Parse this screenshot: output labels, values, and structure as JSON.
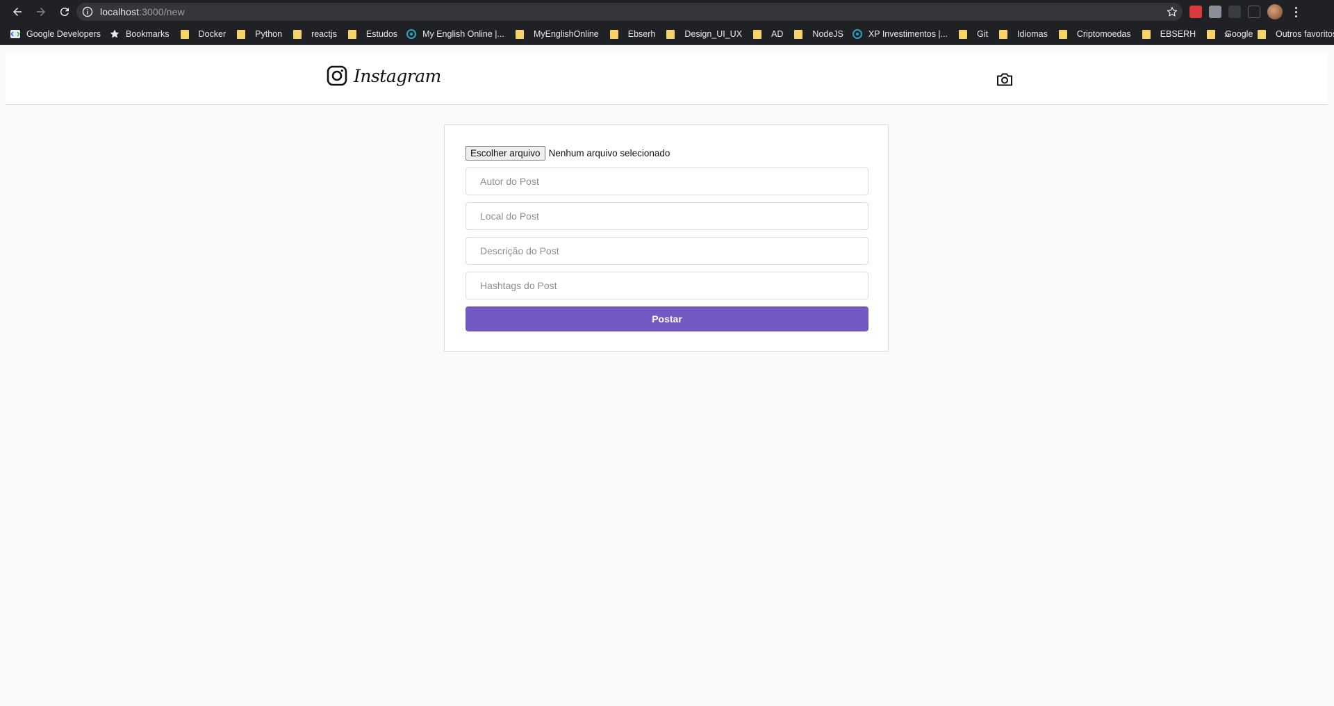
{
  "browser": {
    "url_host": "localhost",
    "url_path": ":3000/new",
    "bookmarks": [
      {
        "label": "Google Developers",
        "icon": "google-developers-icon"
      },
      {
        "label": "Bookmarks",
        "icon": "star-icon"
      },
      {
        "label": "Docker",
        "icon": "folder-icon"
      },
      {
        "label": "Python",
        "icon": "folder-icon"
      },
      {
        "label": "reactjs",
        "icon": "folder-icon"
      },
      {
        "label": "Estudos",
        "icon": "folder-icon"
      },
      {
        "label": "My English Online |...",
        "icon": "site-icon"
      },
      {
        "label": "MyEnglishOnline",
        "icon": "folder-icon"
      },
      {
        "label": "Ebserh",
        "icon": "folder-icon"
      },
      {
        "label": "Design_UI_UX",
        "icon": "folder-icon"
      },
      {
        "label": "AD",
        "icon": "folder-icon"
      },
      {
        "label": "NodeJS",
        "icon": "folder-icon"
      },
      {
        "label": "XP Investimentos |...",
        "icon": "site-icon"
      },
      {
        "label": "Git",
        "icon": "folder-icon"
      },
      {
        "label": "Idiomas",
        "icon": "folder-icon"
      },
      {
        "label": "Criptomoedas",
        "icon": "folder-icon"
      },
      {
        "label": "EBSERH",
        "icon": "folder-icon"
      },
      {
        "label": "Google",
        "icon": "folder-icon"
      }
    ],
    "overflow_label": "»",
    "other_bookmarks": "Outros favoritos"
  },
  "header": {
    "logo_text": "Instagram"
  },
  "form": {
    "file_button": "Escolher arquivo",
    "file_status": "Nenhum arquivo selecionado",
    "author_placeholder": "Autor do Post",
    "place_placeholder": "Local do Post",
    "description_placeholder": "Descrição do Post",
    "hashtags_placeholder": "Hashtags do Post",
    "submit_label": "Postar"
  },
  "colors": {
    "accent": "#7559c3",
    "chrome_bg": "#202124",
    "page_bg": "#fafafa",
    "folder": "#f6d36b"
  }
}
